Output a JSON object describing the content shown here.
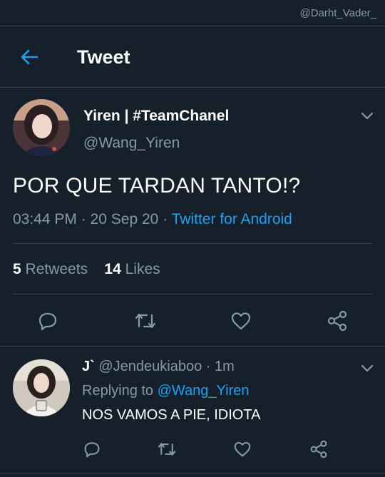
{
  "watermark": "@Darht_Vader_",
  "header": {
    "title": "Tweet"
  },
  "tweet": {
    "display_name": "Yiren | #TeamChanel",
    "handle": "@Wang_Yiren",
    "text": "POR QUE TARDAN TANTO!?",
    "time": "03:44 PM",
    "date": "20 Sep 20",
    "separator": " · ",
    "source": "Twitter for Android",
    "retweets_count": "5",
    "retweets_label": "Retweets",
    "likes_count": "14",
    "likes_label": "Likes"
  },
  "reply": {
    "display_name": "J`",
    "handle": "@Jendeukiaboo",
    "time": "1m",
    "replying_prefix": "Replying to",
    "replying_to": "@Wang_Yiren",
    "text": "NOS VAMOS A PIE, IDIOTA"
  },
  "icons": {
    "back": "back-arrow-icon",
    "reply": "reply-icon",
    "retweet": "retweet-icon",
    "like": "heart-icon",
    "share": "share-icon",
    "more": "chevron-down-icon"
  },
  "colors": {
    "background": "#15202b",
    "accent": "#1da1f2",
    "muted": "#8899a6",
    "divider": "#38444d"
  }
}
